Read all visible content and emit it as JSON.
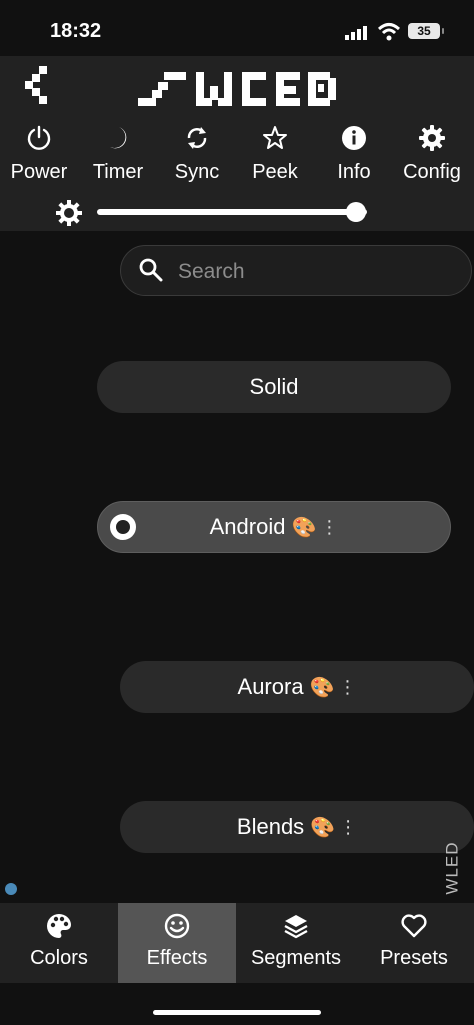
{
  "status_bar": {
    "time": "18:32",
    "battery": "35"
  },
  "header": {
    "logo_text": "WLED",
    "back_icon": "chevron-left-icon"
  },
  "toolbar": {
    "buttons": [
      {
        "label": "Power",
        "icon": "power-icon"
      },
      {
        "label": "Timer",
        "icon": "moon-icon"
      },
      {
        "label": "Sync",
        "icon": "sync-icon"
      },
      {
        "label": "Peek",
        "icon": "star-icon"
      },
      {
        "label": "Info",
        "icon": "info-icon"
      },
      {
        "label": "Config",
        "icon": "gear-icon"
      }
    ],
    "brightness": {
      "icon": "brightness-icon",
      "value_fraction": 0.96
    }
  },
  "search": {
    "placeholder": "Search"
  },
  "effects": [
    {
      "label": "Solid",
      "palette": false
    },
    {
      "label": "Android",
      "palette": true,
      "selected": true
    },
    {
      "label": "Aurora",
      "palette": true
    },
    {
      "label": "Blends",
      "palette": true
    }
  ],
  "palette_glyph": "🎨",
  "menu_glyph": "⋮",
  "side_label": "WLED",
  "bottom_nav": [
    {
      "label": "Colors",
      "icon": "palette-icon"
    },
    {
      "label": "Effects",
      "icon": "smile-icon",
      "active": true
    },
    {
      "label": "Segments",
      "icon": "layers-icon"
    },
    {
      "label": "Presets",
      "icon": "heart-icon"
    }
  ],
  "colors": {
    "bg": "#111111",
    "bar": "#222222",
    "active_tab": "#555555",
    "accent_dot": "#4a8ab8"
  }
}
